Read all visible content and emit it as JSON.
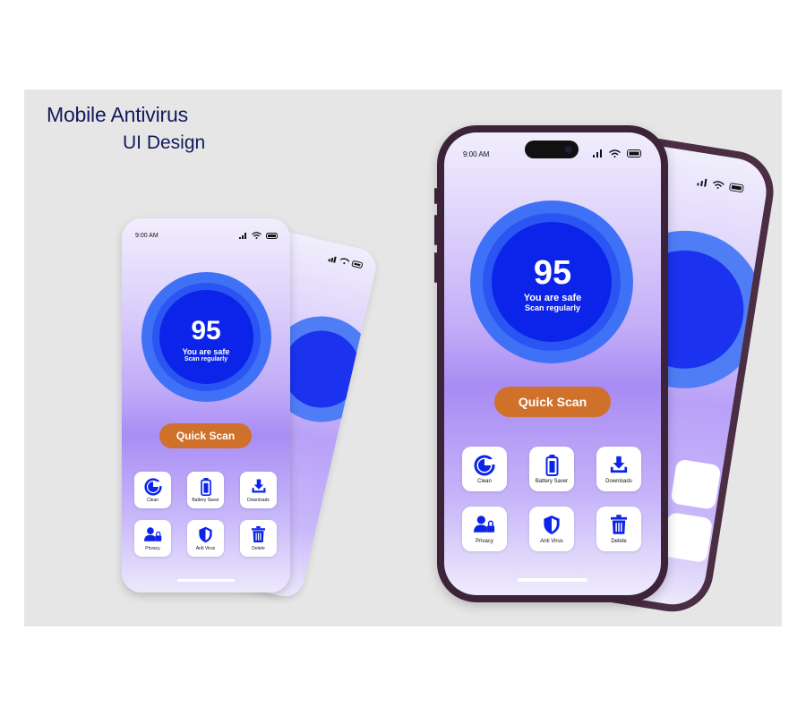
{
  "heading": {
    "line1": "Mobile Antivirus",
    "line2": "UI Design"
  },
  "phone": {
    "time": "9:00 AM",
    "score": "95",
    "status_line": "You are safe",
    "status_sub": "Scan regularly",
    "quick_scan_label": "Quick Scan",
    "tiles": [
      {
        "label": "Clean",
        "icon": "clean-icon"
      },
      {
        "label": "Battery Saver",
        "icon": "battery-icon"
      },
      {
        "label": "Downloads",
        "icon": "download-icon"
      },
      {
        "label": "Privacy",
        "icon": "privacy-icon"
      },
      {
        "label": "Anti Virus",
        "icon": "shield-icon"
      },
      {
        "label": "Delete",
        "icon": "trash-icon"
      }
    ]
  },
  "small_phone": {
    "time": "9:00 AM"
  },
  "colors": {
    "accent_blue": "#0c24ea",
    "button_orange": "#d0712b",
    "heading_navy": "#131a5b"
  }
}
